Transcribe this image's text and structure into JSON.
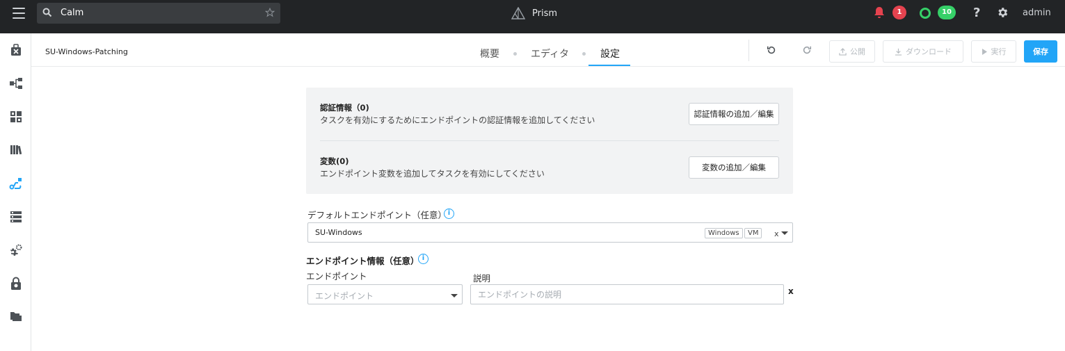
{
  "topbar": {
    "search_value": "Calm",
    "app_name": "Prism",
    "alerts_count": "1",
    "tasks_count": "10",
    "help_label": "?",
    "user_label": "admin",
    "colors": {
      "background": "#222426",
      "alert": "#e5434f",
      "tasks": "#36d068"
    }
  },
  "sidebar": {
    "items": [
      {
        "icon": "applications-icon",
        "active": false
      },
      {
        "icon": "blueprints-icon",
        "active": false
      },
      {
        "icon": "marketplace-icon",
        "active": false
      },
      {
        "icon": "library-icon",
        "active": false
      },
      {
        "icon": "runbooks-icon",
        "active": true
      },
      {
        "icon": "endpoints-icon",
        "active": false
      },
      {
        "icon": "settings-icon",
        "active": false
      },
      {
        "icon": "policies-icon",
        "active": false
      },
      {
        "icon": "projects-icon",
        "active": false
      }
    ]
  },
  "header": {
    "runbook_name": "SU-Windows-Patching",
    "tabs": [
      {
        "label": "概要",
        "active": false
      },
      {
        "label": "エディタ",
        "active": false
      },
      {
        "label": "設定",
        "active": true
      }
    ],
    "publish_label": "公開",
    "download_label": "ダウンロード",
    "run_label": "実行",
    "save_label": "保存",
    "accent_color": "#22a5f7"
  },
  "credentials": {
    "title": "認証情報（0)",
    "description": "タスクを有効にするためにエンドポイントの認証情報を追加してください",
    "button_label": "認証情報の追加／編集"
  },
  "variables": {
    "title": "変数(0)",
    "description": "エンドポイント変数を追加してタスクを有効にしてください",
    "button_label": "変数の追加／編集"
  },
  "default_endpoint": {
    "label": "デフォルトエンドポイント（任意）",
    "value": "SU-Windows",
    "tags": [
      "Windows",
      "VM"
    ],
    "clear_label": "x"
  },
  "endpoint_info": {
    "title": "エンドポイント情報（任意）",
    "endpoint_label": "エンドポイント",
    "endpoint_placeholder": "エンドポイント",
    "description_label": "説明",
    "description_placeholder": "エンドポイントの説明",
    "remove_label": "x"
  }
}
